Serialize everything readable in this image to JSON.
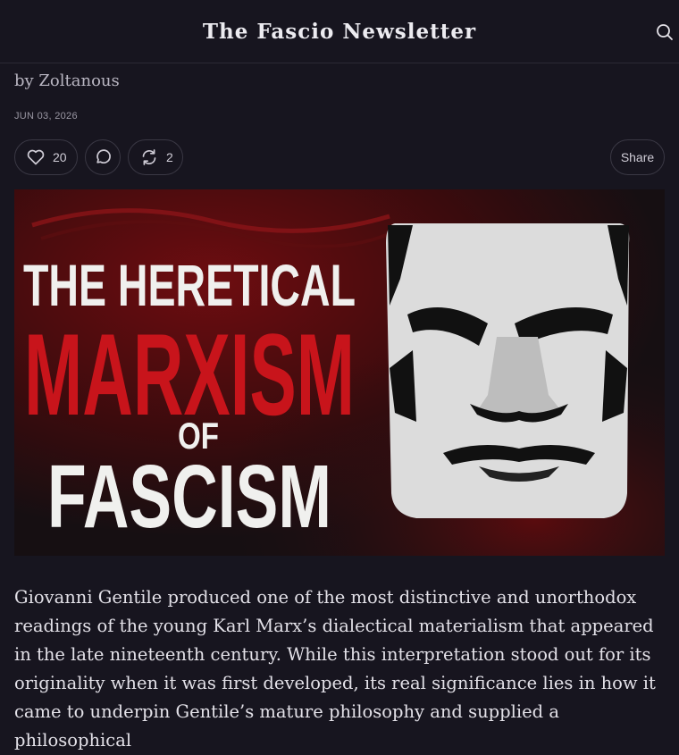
{
  "header": {
    "title": "The Fascio Newsletter",
    "search_icon": "search-icon"
  },
  "post": {
    "byline": "by Zoltanous",
    "date": "JUN 03, 2026"
  },
  "actions": {
    "like_count": "20",
    "restack_count": "2",
    "share_label": "Share",
    "icons": [
      "heart-icon",
      "comment-icon",
      "restack-icon"
    ]
  },
  "hero": {
    "line1": "THE HERETICAL",
    "line2": "MARXISM",
    "line3": "OF",
    "line4": "FASCISM",
    "colors": {
      "red": "#c8141b",
      "white": "#f0f0ee",
      "dark": "#1a1618"
    }
  },
  "article": {
    "paragraph": "Giovanni Gentile produced one of the most distinctive and unorthodox readings of the young Karl Marx’s dialectical materialism that appeared in the late nineteenth century. While this interpretation stood out for its originality when it was first developed, its real significance lies in how it came to underpin Gentile’s mature philosophy and supplied a philosophical"
  },
  "colors": {
    "background": "#17151f",
    "text": "#e6e4ea",
    "muted": "#9a97a3",
    "border": "#3a3844"
  }
}
